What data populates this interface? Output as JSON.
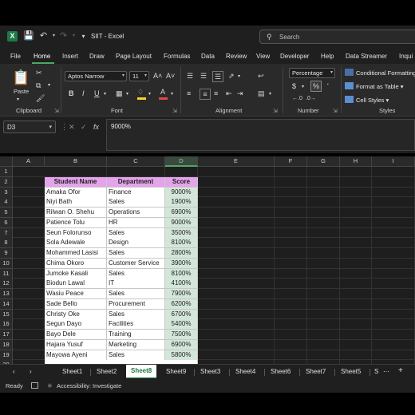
{
  "window": {
    "file_title": "SIIT - Excel",
    "search_placeholder": "Search"
  },
  "menu": {
    "tabs": [
      "File",
      "Home",
      "Insert",
      "Draw",
      "Page Layout",
      "Formulas",
      "Data",
      "Review",
      "View",
      "Developer",
      "Help",
      "Data Streamer",
      "Inqui"
    ],
    "active": "Home"
  },
  "ribbon": {
    "clipboard": {
      "label": "Clipboard",
      "paste": "Paste"
    },
    "font": {
      "label": "Font",
      "family": "Aptos Narrow",
      "size": "11"
    },
    "alignment": {
      "label": "Alignment"
    },
    "number": {
      "label": "Number",
      "format": "Percentage"
    },
    "styles": {
      "label": "Styles",
      "conditional": "Conditional Formatting",
      "format_table": "Format as Table",
      "cell_styles": "Cell Styles"
    },
    "accent_color": "#4ea667",
    "highlight_color": "#f5d327",
    "font_color": "#e04848"
  },
  "formula_bar": {
    "name_box": "D3",
    "fx": "fx",
    "value": "9000%"
  },
  "grid": {
    "columns": [
      "A",
      "B",
      "C",
      "D",
      "E",
      "F",
      "G",
      "H",
      "I"
    ],
    "selected_column": "D",
    "rows": [
      "1",
      "2",
      "3",
      "4",
      "5",
      "6",
      "7",
      "8",
      "9",
      "10",
      "11",
      "12",
      "13",
      "14",
      "15",
      "16",
      "17",
      "18",
      "19",
      "20"
    ],
    "table": {
      "headers": [
        "Student Name",
        "Department",
        "Score"
      ],
      "rows": [
        [
          "Amaka Ofor",
          "Finance",
          "9000%"
        ],
        [
          "Niyi Bath",
          "Sales",
          "1900%"
        ],
        [
          "Rilwan O. Shehu",
          "Operations",
          "6900%"
        ],
        [
          "Patience Tolu",
          "HR",
          "9000%"
        ],
        [
          "Seun Folorunso",
          "Sales",
          "3500%"
        ],
        [
          "Sola Adewale",
          "Design",
          "8100%"
        ],
        [
          "Mohammed Lasisi",
          "Sales",
          "2800%"
        ],
        [
          "Chima Okoro",
          "Customer Service",
          "3900%"
        ],
        [
          "Jumoke Kasali",
          "Sales",
          "8100%"
        ],
        [
          "Biodun Lawal",
          "IT",
          "4100%"
        ],
        [
          "Wasiu Peace",
          "Sales",
          "7900%"
        ],
        [
          "Sade Bello",
          "Procurement",
          "6200%"
        ],
        [
          "Christy Oke",
          "Sales",
          "6700%"
        ],
        [
          "Segun Dayo",
          "Facilities",
          "5400%"
        ],
        [
          "Bayo Dele",
          "Training",
          "7500%"
        ],
        [
          "Hajara Yusuf",
          "Marketing",
          "6900%"
        ],
        [
          "Mayowa Ayeni",
          "Sales",
          "5800%"
        ]
      ],
      "header_color": "#e5a3ec",
      "score_color": "#d3e6da"
    }
  },
  "sheets": {
    "tabs": [
      "Sheet1",
      "Sheet2",
      "Sheet8",
      "Sheet9",
      "Sheet3",
      "Sheet4",
      "Sheet6",
      "Sheet7",
      "Sheet5",
      "S"
    ],
    "active": "Sheet8"
  },
  "status": {
    "ready": "Ready",
    "accessibility": "Accessibility: Investigate"
  }
}
